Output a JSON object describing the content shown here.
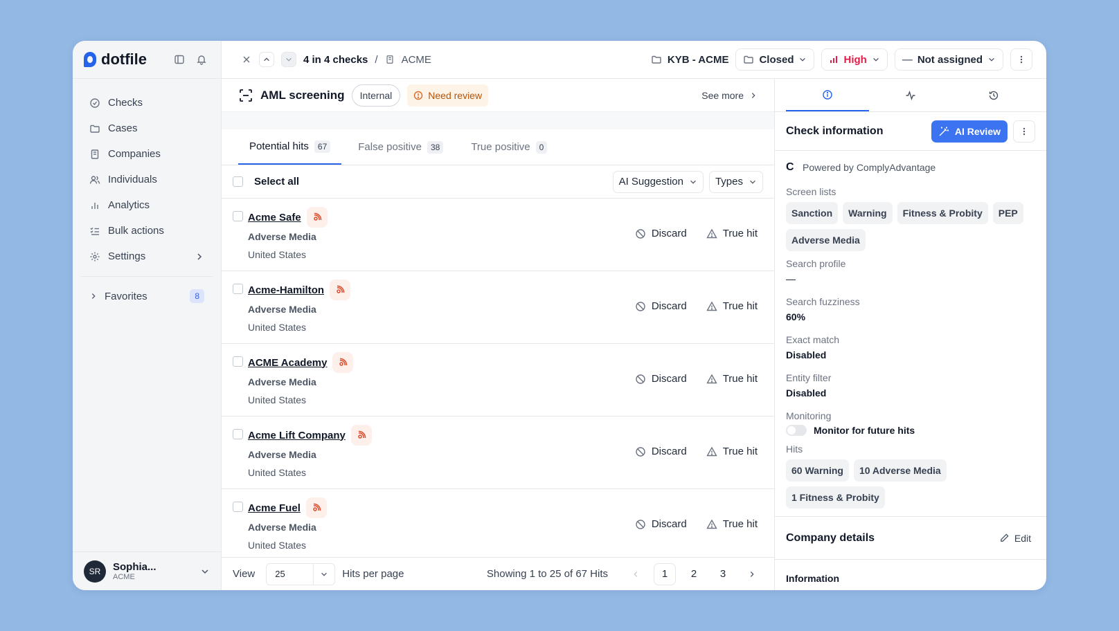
{
  "brand": {
    "name": "dotfile"
  },
  "sidebar": {
    "items": [
      {
        "label": "Checks",
        "icon": "check-circle-icon"
      },
      {
        "label": "Cases",
        "icon": "folder-icon"
      },
      {
        "label": "Companies",
        "icon": "building-icon"
      },
      {
        "label": "Individuals",
        "icon": "users-icon"
      },
      {
        "label": "Analytics",
        "icon": "bar-chart-icon"
      },
      {
        "label": "Bulk actions",
        "icon": "list-check-icon"
      },
      {
        "label": "Settings",
        "icon": "gear-icon"
      }
    ],
    "favorites": {
      "label": "Favorites",
      "count": "8"
    },
    "user": {
      "initials": "SR",
      "name": "Sophia...",
      "org": "ACME"
    }
  },
  "topbar": {
    "position": "4 in 4 checks",
    "separator": "/",
    "entity": "ACME",
    "case": "KYB - ACME",
    "status": "Closed",
    "risk": "High",
    "assignee": "Not assigned",
    "risk_color": "#e11d48"
  },
  "check": {
    "title": "AML screening",
    "tag": "Internal",
    "status": "Need review",
    "see_more": "See more"
  },
  "tabs": [
    {
      "label": "Potential hits",
      "count": "67"
    },
    {
      "label": "False positive",
      "count": "38"
    },
    {
      "label": "True positive",
      "count": "0"
    }
  ],
  "toolbar": {
    "select_all": "Select all",
    "ai_suggestion": "AI Suggestion",
    "types": "Types"
  },
  "hits": [
    {
      "name": "Acme Safe",
      "type": "Adverse Media",
      "country": "United States"
    },
    {
      "name": "Acme-Hamilton",
      "type": "Adverse Media",
      "country": "United States"
    },
    {
      "name": "ACME Academy",
      "type": "Adverse Media",
      "country": "United States"
    },
    {
      "name": "Acme Lift Company",
      "type": "Adverse Media",
      "country": "United States"
    },
    {
      "name": "Acme Fuel",
      "type": "Adverse Media",
      "country": "United States"
    }
  ],
  "hit_actions": {
    "discard": "Discard",
    "true_hit": "True hit"
  },
  "pager": {
    "view": "View",
    "per_page": "25",
    "per_page_label": "Hits per page",
    "showing": "Showing 1 to 25 of 67 Hits",
    "pages": [
      "1",
      "2",
      "3"
    ]
  },
  "panel": {
    "title": "Check information",
    "ai_review": "AI Review",
    "powered_by": "Powered by ComplyAdvantage",
    "screen_lists_label": "Screen lists",
    "screen_lists": [
      "Sanction",
      "Warning",
      "Fitness & Probity",
      "PEP",
      "Adverse Media"
    ],
    "search_profile_label": "Search profile",
    "search_profile": "—",
    "fuzziness_label": "Search fuzziness",
    "fuzziness": "60%",
    "exact_match_label": "Exact match",
    "exact_match": "Disabled",
    "entity_filter_label": "Entity filter",
    "entity_filter": "Disabled",
    "monitoring_label": "Monitoring",
    "monitoring_text": "Monitor for future hits",
    "hits_label": "Hits",
    "hits": [
      "60 Warning",
      "10 Adverse Media",
      "1 Fitness & Probity"
    ],
    "company_details": "Company details",
    "edit": "Edit",
    "information": "Information"
  },
  "colors": {
    "accent": "#2563eb",
    "warning": "#b45309",
    "media": "#dc4a2a"
  }
}
